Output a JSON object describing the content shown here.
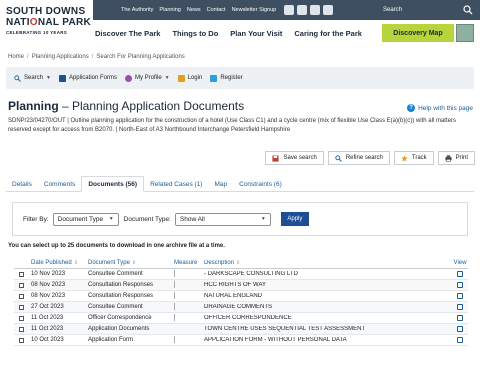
{
  "header": {
    "logo": {
      "line1": "SOUTH DOWNS",
      "line2a": "NATI",
      "line2b": "O",
      "line2c": "NAL PARK",
      "line3": "CELEBRATING 10 YEARS"
    },
    "top_links": [
      "The Authority",
      "Planning",
      "News",
      "Contact",
      "Newsletter Signup"
    ],
    "search_placeholder": "Search",
    "main_nav": [
      "Discover The Park",
      "Things to Do",
      "Plan Your Visit",
      "Caring for the Park"
    ],
    "discover_map": "Discovery Map"
  },
  "breadcrumb": [
    "Home",
    "Planning Applications",
    "Search For Planning Applications"
  ],
  "account_bar": {
    "search": "Search",
    "forms": "Application Forms",
    "profile": "My Profile",
    "login": "Login",
    "register": "Register"
  },
  "page": {
    "title_bold": "Planning",
    "title_rest": " – Planning Application Documents",
    "help": "Help with this page",
    "description": "SDNP/23/04270/OUT | Outline planning application for the construction of a hotel (Use Class C1) and a cycle centre (mix of flexible Use Class E(a)(b)(c)) with all matters reserved except for access from B2070. | North-East of A3 Northbound Interchange Petersfield Hampshire"
  },
  "actions": {
    "save": "Save search",
    "refine": "Refine search",
    "track": "Track",
    "print": "Print"
  },
  "tabs": [
    "Details",
    "Comments",
    "Documents (56)",
    "Related Cases (1)",
    "Map",
    "Constraints (6)"
  ],
  "filter": {
    "filter_by_label": "Filter By:",
    "filter_by_value": "Document Type",
    "doc_type_label": "Document Type:",
    "doc_type_value": "Show All",
    "apply": "Apply"
  },
  "note": "You can select up to 25 documents to download in one archive file at a time.",
  "table": {
    "headers": [
      "Date Published",
      "Document Type",
      "Measure",
      "Description",
      "View"
    ],
    "rows": [
      {
        "date": "10 Nov 2023",
        "type": "Consultee Comment",
        "desc": "- DARKSCAPE CONSULTING LTD",
        "gold": false
      },
      {
        "date": "08 Nov 2023",
        "type": "Consultation Responses",
        "desc": "HCC RIGHTS OF WAY",
        "gold": false
      },
      {
        "date": "08 Nov 2023",
        "type": "Consultation Responses",
        "desc": "NATURAL ENGLAND",
        "gold": false
      },
      {
        "date": "27 Oct 2023",
        "type": "Consultee Comment",
        "desc": "DRAINAGE COMMENTS",
        "gold": false
      },
      {
        "date": "11 Oct 2023",
        "type": "Officer Correspondence",
        "desc": "OFFICER CORRESPONDENCE",
        "gold": false
      },
      {
        "date": "11 Oct 2023",
        "type": "Application Documents",
        "desc": "TOWN CENTRE USES SEQUENTIAL TEST ASSESSMENT",
        "gold": true
      },
      {
        "date": "10 Oct 2023",
        "type": "Application Form",
        "desc": "APPLICATION FORM - WITHOUT PERSONAL DATA",
        "gold": false
      }
    ]
  },
  "colors": {
    "nav_dark": "#3d4f61",
    "accent_green": "#b7d43c",
    "link_blue": "#1b5e9a",
    "apply_blue": "#1d4f95"
  }
}
